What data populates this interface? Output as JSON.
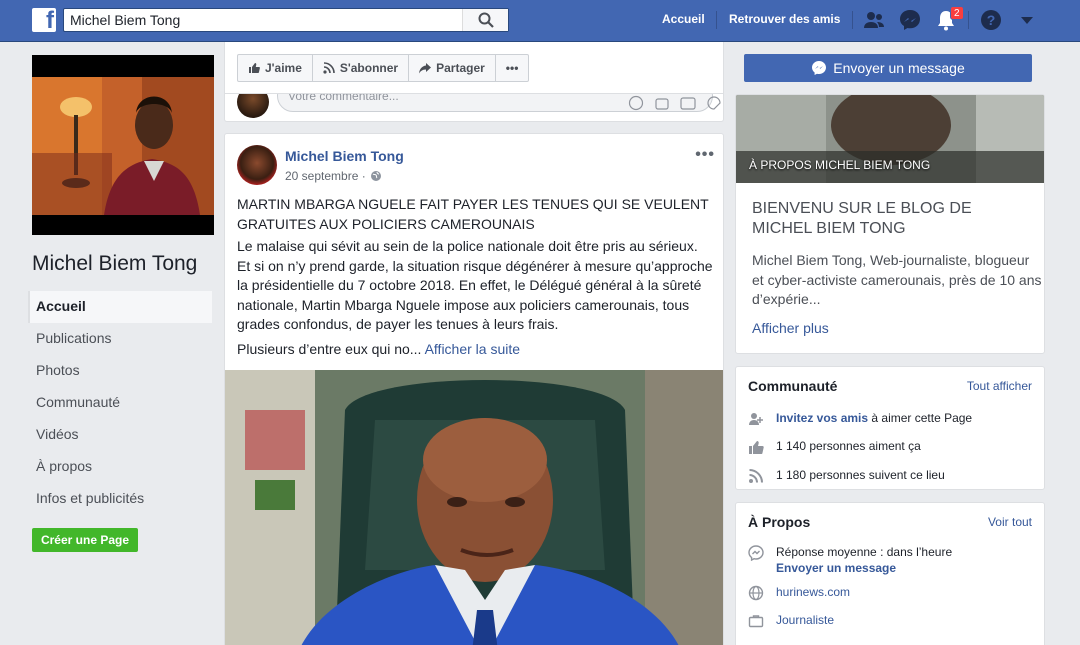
{
  "topbar": {
    "search_value": "Michel Biem Tong",
    "nav_home": "Accueil",
    "nav_find_friends": "Retrouver des amis",
    "notification_count": "2"
  },
  "left": {
    "page_name": "Michel Biem Tong",
    "nav": [
      {
        "label": "Accueil",
        "active": true
      },
      {
        "label": "Publications"
      },
      {
        "label": "Photos"
      },
      {
        "label": "Communauté"
      },
      {
        "label": "Vidéos"
      },
      {
        "label": "À propos"
      },
      {
        "label": "Infos et publicités"
      }
    ],
    "create_page": "Créer une Page"
  },
  "actions": {
    "like": "J'aime",
    "follow": "S'abonner",
    "share": "Partager",
    "more": "•••",
    "send_message": "Envoyer un message"
  },
  "comment": {
    "placeholder": "Votre commentaire..."
  },
  "post": {
    "author": "Michel Biem Tong",
    "date": "20 septembre ·",
    "more": "•••",
    "headline": "MARTIN MBARGA NGUELE FAIT PAYER LES TENUES QUI SE VEULENT GRATUITES AUX POLICIERS CAMEROUNAIS",
    "body": "Le malaise qui sévit au sein de la police nationale doit être pris au sérieux. Et si on n’y prend garde, la situation risque dégénérer à mesure qu’approche la présidentielle du 7 octobre 2018. En effet, le Délégué général à la sûreté nationale, Martin Mbarga Nguele impose aux policiers camerounais, tous grades confondus, de payer les tenues à leurs frais.",
    "teaser": "Plusieurs d’entre eux qui no...",
    "see_more": "Afficher la suite"
  },
  "about": {
    "photo_label": "À PROPOS MICHEL BIEM TONG",
    "title": "BIENVENU SUR LE BLOG DE MICHEL BIEM TONG",
    "desc": "Michel Biem Tong, Web-journaliste, blogueur et cyber-activiste camerounais, près de 10 ans d’expérie...",
    "show_more": "Afficher plus"
  },
  "community": {
    "title": "Communauté",
    "see_all": "Tout afficher",
    "invite_link": "Invitez vos amis",
    "invite_rest": " à aimer cette Page",
    "likes": "1 140 personnes aiment ça",
    "follows": "1 180 personnes suivent ce lieu"
  },
  "apropos": {
    "title": "À Propos",
    "see_all": "Voir tout",
    "response": "Réponse moyenne : dans l’heure",
    "send_message": "Envoyer un message",
    "website": "hurinews.com",
    "category": "Journaliste"
  },
  "colors": {
    "brand": "#4267b2",
    "link": "#365899",
    "create_page": "#42b72a",
    "badge": "#fa3e3e"
  },
  "icons": [
    "facebook-logo-icon",
    "search-icon",
    "friends-icon",
    "messenger-icon",
    "bell-icon",
    "help-icon",
    "caret-down-icon",
    "thumbs-up-icon",
    "rss-icon",
    "share-icon",
    "globe-icon",
    "smile-icon",
    "camera-icon",
    "gif-icon",
    "sticker-icon",
    "invite-icon",
    "link-icon",
    "briefcase-icon"
  ]
}
